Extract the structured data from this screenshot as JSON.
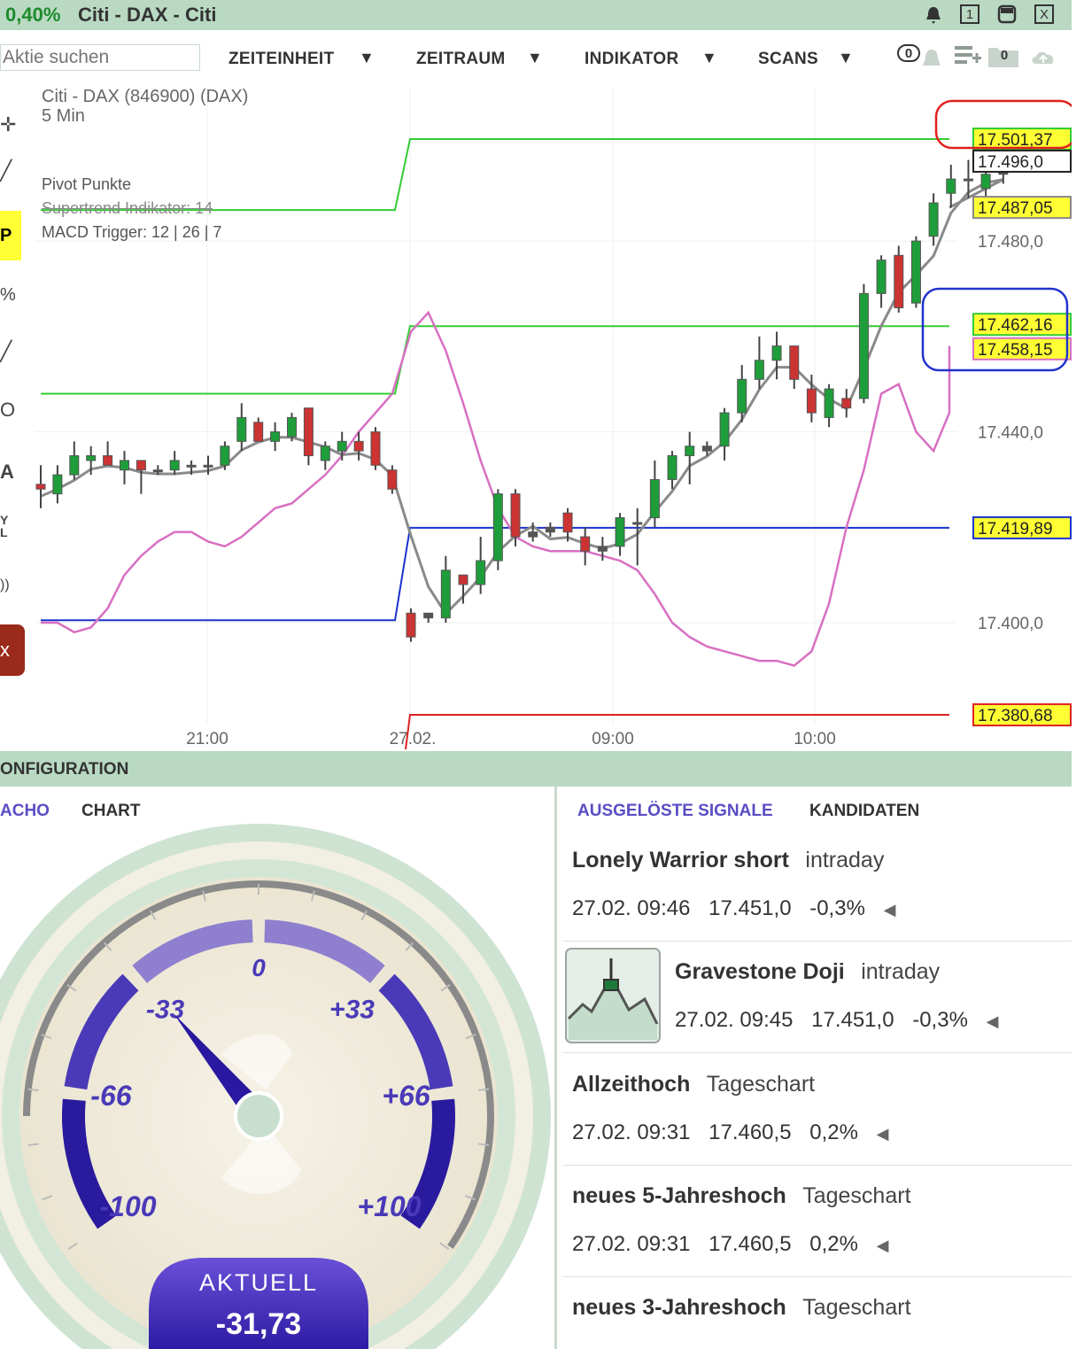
{
  "window": {
    "change_pct": "0,40%",
    "title": "Citi - DAX - Citi",
    "buttons": [
      "1",
      "X"
    ]
  },
  "toolbar": {
    "search_placeholder": "Aktie suchen",
    "menus": [
      "ZEITEINHEIT",
      "ZEITRAUM",
      "INDIKATOR",
      "SCANS"
    ],
    "badge_left": "0",
    "badge_right": "0"
  },
  "chart": {
    "instrument": "Citi - DAX (846900) (DAX)",
    "timeframe": "5 Min",
    "indicators": [
      "Pivot Punkte",
      "Supertrend Indikator: 14",
      "MACD Trigger: 12 | 26 | 7"
    ],
    "price_labels": [
      "17.480,0",
      "17.440,0",
      "17.400,0"
    ],
    "tag_labels": [
      "17.501,37",
      "17.496,0",
      "17.487,05",
      "17.462,16",
      "17.458,15",
      "17.419,89",
      "17.380,68"
    ],
    "time_labels": [
      "21:00",
      "27.02.",
      "09:00",
      "10:00"
    ]
  },
  "chart_data": {
    "type": "candlestick",
    "title": "Citi - DAX (846900) (DAX)",
    "timeframe": "5 Min",
    "time_axis": [
      "21:00",
      "27.02.",
      "09:00",
      "10:00"
    ],
    "y_ticks": [
      17400.0,
      17440.0,
      17480.0
    ],
    "ylim": [
      17372,
      17510
    ],
    "candles": [
      {
        "o": 17429.0,
        "h": 17433.0,
        "l": 17424.0,
        "c": 17428.0,
        "dir": "down"
      },
      {
        "o": 17427.0,
        "h": 17433.0,
        "l": 17425.0,
        "c": 17431.0,
        "dir": "up"
      },
      {
        "o": 17431.0,
        "h": 17438.0,
        "l": 17430.0,
        "c": 17435.0,
        "dir": "up"
      },
      {
        "o": 17434.0,
        "h": 17437.0,
        "l": 17431.0,
        "c": 17435.0,
        "dir": "up"
      },
      {
        "o": 17435.0,
        "h": 17438.0,
        "l": 17433.0,
        "c": 17433.0,
        "dir": "down"
      },
      {
        "o": 17432.0,
        "h": 17436.0,
        "l": 17429.0,
        "c": 17434.0,
        "dir": "up"
      },
      {
        "o": 17434.0,
        "h": 17434.0,
        "l": 17427.0,
        "c": 17432.0,
        "dir": "down"
      },
      {
        "o": 17432.0,
        "h": 17433.0,
        "l": 17431.0,
        "c": 17432.0,
        "dir": "flat"
      },
      {
        "o": 17432.0,
        "h": 17436.0,
        "l": 17431.0,
        "c": 17434.0,
        "dir": "up"
      },
      {
        "o": 17433.0,
        "h": 17434.0,
        "l": 17431.0,
        "c": 17433.0,
        "dir": "flat"
      },
      {
        "o": 17433.0,
        "h": 17435.0,
        "l": 17431.0,
        "c": 17433.0,
        "dir": "flat"
      },
      {
        "o": 17433.0,
        "h": 17438.0,
        "l": 17432.0,
        "c": 17437.0,
        "dir": "up"
      },
      {
        "o": 17438.0,
        "h": 17446.0,
        "l": 17436.0,
        "c": 17443.0,
        "dir": "up"
      },
      {
        "o": 17442.0,
        "h": 17443.0,
        "l": 17438.0,
        "c": 17438.0,
        "dir": "down"
      },
      {
        "o": 17438.0,
        "h": 17442.0,
        "l": 17436.0,
        "c": 17440.0,
        "dir": "up"
      },
      {
        "o": 17439.0,
        "h": 17444.0,
        "l": 17438.0,
        "c": 17443.0,
        "dir": "up"
      },
      {
        "o": 17445.0,
        "h": 17445.0,
        "l": 17433.0,
        "c": 17435.0,
        "dir": "down"
      },
      {
        "o": 17434.0,
        "h": 17438.0,
        "l": 17432.0,
        "c": 17437.0,
        "dir": "up"
      },
      {
        "o": 17436.0,
        "h": 17440.0,
        "l": 17434.0,
        "c": 17438.0,
        "dir": "up"
      },
      {
        "o": 17438.0,
        "h": 17440.0,
        "l": 17434.0,
        "c": 17436.0,
        "dir": "down"
      },
      {
        "o": 17440.0,
        "h": 17441.0,
        "l": 17432.0,
        "c": 17433.0,
        "dir": "down"
      },
      {
        "o": 17432.0,
        "h": 17433.0,
        "l": 17427.0,
        "c": 17428.0,
        "dir": "down"
      },
      {
        "o": 17402.0,
        "h": 17403.0,
        "l": 17396.0,
        "c": 17397.0,
        "dir": "down"
      },
      {
        "o": 17402.0,
        "h": 17402.0,
        "l": 17400.0,
        "c": 17401.0,
        "dir": "flat"
      },
      {
        "o": 17401.0,
        "h": 17414.0,
        "l": 17400.0,
        "c": 17411.0,
        "dir": "up"
      },
      {
        "o": 17410.0,
        "h": 17410.0,
        "l": 17404.0,
        "c": 17408.0,
        "dir": "down"
      },
      {
        "o": 17408.0,
        "h": 17418.0,
        "l": 17406.0,
        "c": 17413.0,
        "dir": "up"
      },
      {
        "o": 17413.0,
        "h": 17428.0,
        "l": 17411.0,
        "c": 17427.0,
        "dir": "up"
      },
      {
        "o": 17427.0,
        "h": 17428.0,
        "l": 17416.0,
        "c": 17418.0,
        "dir": "down"
      },
      {
        "o": 17418.0,
        "h": 17421.0,
        "l": 17417.0,
        "c": 17419.0,
        "dir": "flat"
      },
      {
        "o": 17420.0,
        "h": 17421.0,
        "l": 17418.0,
        "c": 17419.0,
        "dir": "flat"
      },
      {
        "o": 17423.0,
        "h": 17424.0,
        "l": 17417.0,
        "c": 17419.0,
        "dir": "down"
      },
      {
        "o": 17418.0,
        "h": 17420.0,
        "l": 17412.0,
        "c": 17415.0,
        "dir": "down"
      },
      {
        "o": 17415.0,
        "h": 17418.0,
        "l": 17413.0,
        "c": 17416.0,
        "dir": "flat"
      },
      {
        "o": 17416.0,
        "h": 17423.0,
        "l": 17414.0,
        "c": 17422.0,
        "dir": "up"
      },
      {
        "o": 17421.0,
        "h": 17424.0,
        "l": 17412.0,
        "c": 17421.0,
        "dir": "flat"
      },
      {
        "o": 17422.0,
        "h": 17434.0,
        "l": 17420.0,
        "c": 17430.0,
        "dir": "up"
      },
      {
        "o": 17430.0,
        "h": 17436.0,
        "l": 17428.0,
        "c": 17435.0,
        "dir": "up"
      },
      {
        "o": 17435.0,
        "h": 17440.0,
        "l": 17429.0,
        "c": 17437.0,
        "dir": "up"
      },
      {
        "o": 17437.0,
        "h": 17438.0,
        "l": 17435.0,
        "c": 17436.0,
        "dir": "flat"
      },
      {
        "o": 17437.0,
        "h": 17445.0,
        "l": 17434.0,
        "c": 17444.0,
        "dir": "up"
      },
      {
        "o": 17444.0,
        "h": 17454.0,
        "l": 17442.0,
        "c": 17451.0,
        "dir": "up"
      },
      {
        "o": 17451.0,
        "h": 17460.0,
        "l": 17449.0,
        "c": 17455.0,
        "dir": "up"
      },
      {
        "o": 17455.0,
        "h": 17461.0,
        "l": 17451.0,
        "c": 17458.0,
        "dir": "up"
      },
      {
        "o": 17458.0,
        "h": 17458.0,
        "l": 17449.0,
        "c": 17451.0,
        "dir": "down"
      },
      {
        "o": 17449.0,
        "h": 17452.0,
        "l": 17442.0,
        "c": 17444.0,
        "dir": "down"
      },
      {
        "o": 17443.0,
        "h": 17450.0,
        "l": 17441.0,
        "c": 17449.0,
        "dir": "up"
      },
      {
        "o": 17447.0,
        "h": 17449.0,
        "l": 17443.0,
        "c": 17445.0,
        "dir": "down"
      },
      {
        "o": 17447.0,
        "h": 17471.0,
        "l": 17446.0,
        "c": 17469.0,
        "dir": "up"
      },
      {
        "o": 17469.0,
        "h": 17477.0,
        "l": 17466.0,
        "c": 17476.0,
        "dir": "up"
      },
      {
        "o": 17477.0,
        "h": 17479.0,
        "l": 17465.0,
        "c": 17466.0,
        "dir": "down"
      },
      {
        "o": 17467.0,
        "h": 17481.0,
        "l": 17466.0,
        "c": 17480.0,
        "dir": "up"
      },
      {
        "o": 17481.0,
        "h": 17490.0,
        "l": 17479.0,
        "c": 17488.0,
        "dir": "up"
      },
      {
        "o": 17490.0,
        "h": 17496.0,
        "l": 17487.0,
        "c": 17493.0,
        "dir": "up"
      },
      {
        "o": 17493.0,
        "h": 17497.0,
        "l": 17489.0,
        "c": 17493.0,
        "dir": "flat"
      },
      {
        "o": 17491.0,
        "h": 17496.0,
        "l": 17489.0,
        "c": 17494.0,
        "dir": "up"
      },
      {
        "o": 17494.0,
        "h": 17496.0,
        "l": 17492.0,
        "c": 17495.0,
        "dir": "flat"
      }
    ],
    "pivot_levels": [
      {
        "name": "R2",
        "value": 17501.37,
        "color": "#33cc33"
      },
      {
        "name": "R1",
        "value": 17462.16,
        "color": "#33cc33"
      },
      {
        "name": "P",
        "value": 17419.89,
        "color": "#1a33cc"
      },
      {
        "name": "S1",
        "value": 17380.68,
        "color": "#dd2222"
      }
    ],
    "prior_pivot_levels": [
      {
        "value": 17486.5,
        "color": "#33cc33"
      },
      {
        "value": 17448.0,
        "color": "#33cc33"
      },
      {
        "value": 17400.5,
        "color": "#1a33cc"
      }
    ],
    "supertrend_value": 17487.05,
    "macd_trigger_value": 17458.15,
    "last_price": 17496.0
  },
  "config": {
    "label": "ONFIGURATION"
  },
  "left_tabs": [
    "ACHO",
    "CHART"
  ],
  "gauge": {
    "labels": [
      "0",
      "-33",
      "+33",
      "-66",
      "+66",
      "-100",
      "+100"
    ],
    "current_label": "AKTUELL",
    "current_value": "-31,73",
    "value": -31.73,
    "colors": {
      "arc_light": "#8f7fcf",
      "arc_dark": "#2a1a9e",
      "hub": "#c8dfcf"
    }
  },
  "right_tabs": [
    "AUSGELÖSTE SIGNALE",
    "KANDIDATEN"
  ],
  "signals": [
    {
      "name": "Lonely Warrior short",
      "type": "intraday",
      "date": "27.02. 09:46",
      "price": "17.451,0",
      "change": "-0,3%"
    },
    {
      "name": "Gravestone Doji",
      "type": "intraday",
      "date": "27.02. 09:45",
      "price": "17.451,0",
      "change": "-0,3%"
    },
    {
      "name": "Allzeithoch",
      "type": "Tageschart",
      "date": "27.02. 09:31",
      "price": "17.460,5",
      "change": "0,2%"
    },
    {
      "name": "neues 5-Jahreshoch",
      "type": "Tageschart",
      "date": "27.02. 09:31",
      "price": "17.460,5",
      "change": "0,2%"
    },
    {
      "name": "neues 3-Jahreshoch",
      "type": "Tageschart",
      "date": "",
      "price": "",
      "change": ""
    }
  ],
  "colors": {
    "accent": "#5a4dc4",
    "panel_green": "#b9d9c2",
    "candle_up": "#1e9e3a",
    "candle_down": "#cc3333",
    "tag_yellow": "#ffff33"
  }
}
